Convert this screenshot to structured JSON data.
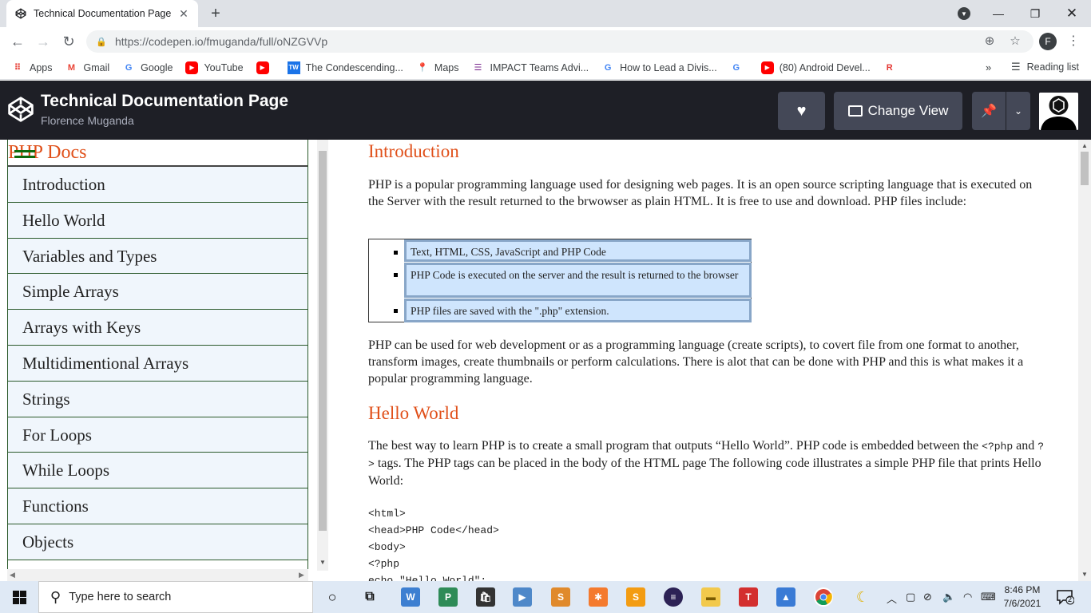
{
  "browser": {
    "tab_title": "Technical Documentation Page",
    "url": "https://codepen.io/fmuganda/full/oNZGVVp",
    "profile_initial": "F",
    "bookmarks": [
      {
        "label": "Apps",
        "icon": "apps-grid-icon",
        "color": "#e8453c"
      },
      {
        "label": "Gmail",
        "icon": "gmail-icon",
        "color": "#ea4335"
      },
      {
        "label": "Google",
        "icon": "google-icon",
        "color": "#4285f4"
      },
      {
        "label": "YouTube",
        "icon": "youtube-icon",
        "color": "#ff0000"
      },
      {
        "label": "",
        "icon": "youtube-icon",
        "color": "#ff0000"
      },
      {
        "label": "The Condescending...",
        "icon": "tw-icon",
        "color": "#1a73e8"
      },
      {
        "label": "Maps",
        "icon": "maps-pin-icon",
        "color": "#34a853"
      },
      {
        "label": "IMPACT Teams Advi...",
        "icon": "list-icon",
        "color": "#7b2a8f"
      },
      {
        "label": "How to Lead a Divis...",
        "icon": "google-icon",
        "color": "#4285f4"
      },
      {
        "label": "",
        "icon": "google-icon",
        "color": "#4285f4"
      },
      {
        "label": "(80) Android Devel...",
        "icon": "youtube-icon",
        "color": "#ff0000"
      },
      {
        "label": "",
        "icon": "r-icon",
        "color": "#e53935"
      }
    ],
    "more_label": "»",
    "reading_list_label": "Reading list"
  },
  "codepen": {
    "title": "Technical Documentation Page",
    "author": "Florence Muganda",
    "change_view_label": "Change View"
  },
  "sidebar": {
    "header": "PHP Docs",
    "items": [
      "Introduction",
      "Hello World",
      "Variables and Types",
      "Simple Arrays",
      "Arrays with Keys",
      "Multidimentional Arrays",
      "Strings",
      "For Loops",
      "While Loops",
      "Functions",
      "Objects"
    ]
  },
  "main": {
    "intro_heading": "Introduction",
    "intro_p1": "PHP is a popular programming language used for designing web pages. It is an open source scripting language that is executed on the Server with the result returned to the brwowser as plain HTML. It is free to use and download. PHP files include:",
    "intro_list": [
      "Text, HTML, CSS, JavaScript and PHP Code",
      "PHP Code is executed on the server and the result is returned to the browser",
      "PHP files are saved with the \".php\" extension."
    ],
    "intro_p2": "PHP can be used for web development or as a programming language (create scripts), to covert file from one format to another, transform images, create thumbnails or perform calculations. There is alot that can be done with PHP and this is what makes it a popular programming language.",
    "hello_heading": "Hello World",
    "hello_p_a": "The best way to learn PHP is to create a small program that outputs “Hello World”. PHP code is embedded between the",
    "hello_code_open": "<?php",
    "hello_and": "and",
    "hello_code_close": "?>",
    "hello_p_b": "tags. The PHP tags can be placed in the body of the HTML page The following code illustrates a simple PHP file that prints Hello World:",
    "code_lines": [
      "<html>",
      "<head>PHP Code</head>",
      "<body>",
      "<?php",
      "echo \"Hello World\";"
    ]
  },
  "taskbar": {
    "search_placeholder": "Type here to search",
    "time": "8:46 PM",
    "date": "7/6/2021",
    "notification_count": "2"
  }
}
